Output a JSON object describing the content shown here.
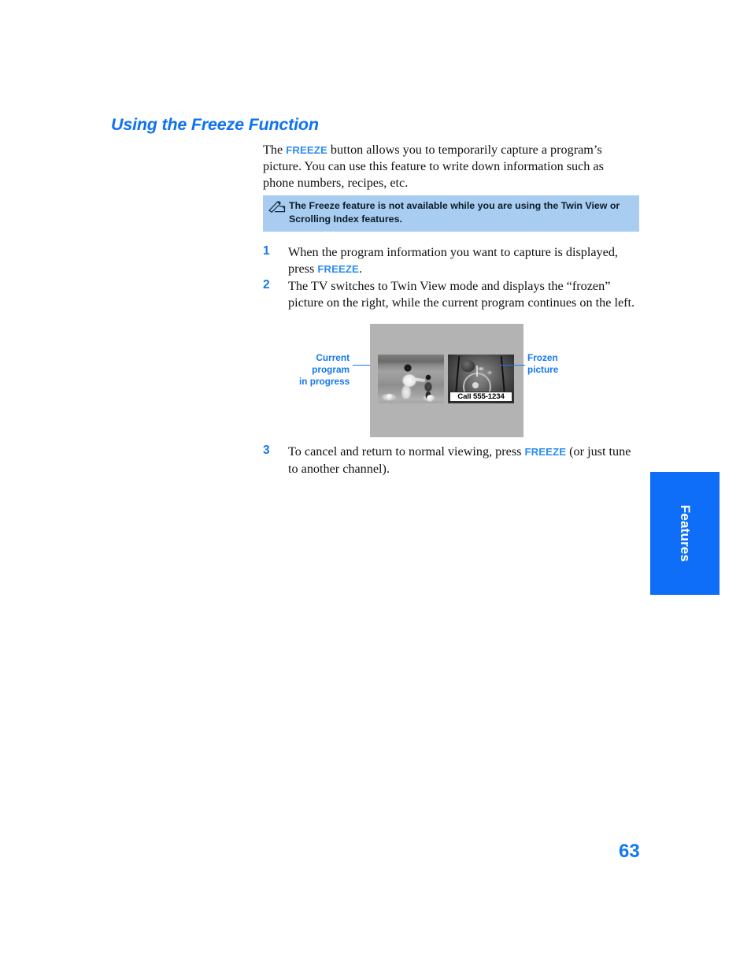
{
  "page": {
    "number": "63",
    "side_tab_label": "Features",
    "accent_blue": "#1479ef",
    "heading_blue": "#0f72f0",
    "note_background": "#a8cdf0",
    "tab_background": "#0f6ef7"
  },
  "heading": "Using the Freeze Function",
  "intro": {
    "before": "The ",
    "key": "FREEZE",
    "after": " button allows you to temporarily capture a program’s picture. You can use this feature to write down information such as phone numbers, recipes, etc."
  },
  "note": {
    "icon": "pencil-note-icon",
    "text": "The Freeze feature is not available while you are using the Twin View or Scrolling Index features."
  },
  "steps": [
    {
      "number": "1",
      "before": "When the program information you want to capture is displayed, press ",
      "key": "FREEZE",
      "after": "."
    },
    {
      "number": "2",
      "before": "The TV switches to Twin View mode and displays the “frozen” picture on the right, while the current program continues on the left.",
      "key": "",
      "after": ""
    },
    {
      "number": "3",
      "before": "To cancel and return to normal viewing, press ",
      "key": "FREEZE",
      "after": " (or just tune to another channel)."
    }
  ],
  "figure": {
    "callout_left": "Current\nprogram\nin progress",
    "callout_left_lines": [
      "Current",
      "program",
      "in progress"
    ],
    "callout_right_lines": [
      "Frozen",
      "picture"
    ],
    "left_screen_alt": "current-program-photo",
    "right_screen_alt": "frozen-picture-photo",
    "caption": "Call 555-1234"
  }
}
